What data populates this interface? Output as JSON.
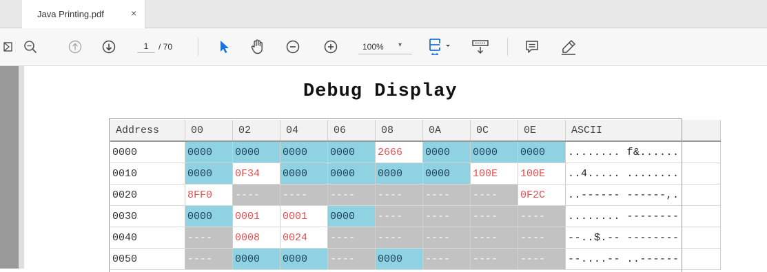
{
  "tab": {
    "title": "Java Printing.pdf",
    "close": "×"
  },
  "toolbar": {
    "page_current": "1",
    "page_total": "/ 70",
    "zoom": "100%",
    "zoom_caret": "▾"
  },
  "document": {
    "title": "Debug Display"
  },
  "table": {
    "headers": [
      "Address",
      "00",
      "02",
      "04",
      "06",
      "08",
      "0A",
      "0C",
      "0E",
      "ASCII"
    ],
    "rows": [
      {
        "addr": "0000",
        "cells": [
          "0000",
          "0000",
          "0000",
          "0000",
          "2666",
          "0000",
          "0000",
          "0000"
        ],
        "ascii": "........ f&......"
      },
      {
        "addr": "0010",
        "cells": [
          "0000",
          "0F34",
          "0000",
          "0000",
          "0000",
          "0000",
          "100E",
          "100E"
        ],
        "ascii": "..4..... ........"
      },
      {
        "addr": "0020",
        "cells": [
          "8FF0",
          "----",
          "----",
          "----",
          "----",
          "----",
          "----",
          "0F2C"
        ],
        "ascii": "..------ ------,."
      },
      {
        "addr": "0030",
        "cells": [
          "0000",
          "0001",
          "0001",
          "0000",
          "----",
          "----",
          "----",
          "----"
        ],
        "ascii": "........ --------"
      },
      {
        "addr": "0040",
        "cells": [
          "----",
          "0008",
          "0024",
          "----",
          "----",
          "----",
          "----",
          "----"
        ],
        "ascii": "--..$.-- --------"
      },
      {
        "addr": "0050",
        "cells": [
          "----",
          "0000",
          "0000",
          "----",
          "0000",
          "----",
          "----",
          "----"
        ],
        "ascii": "--....-- ..------"
      }
    ]
  },
  "colors": {
    "zero_cell": "#8fd3e2",
    "changed_text": "#e35050",
    "undefined_cell": "#c2c2c2",
    "cursor_tool": "#1a73d9",
    "fit_tool": "#1a73d9"
  }
}
